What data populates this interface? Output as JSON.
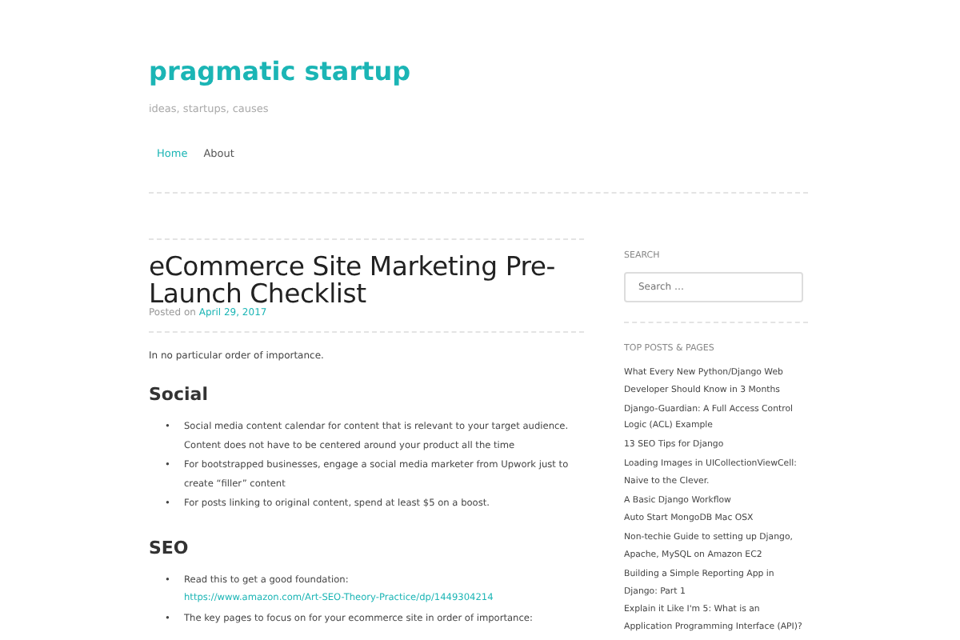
{
  "site": {
    "title": "pragmatic startup",
    "tagline": "ideas, startups, causes"
  },
  "nav": [
    {
      "label": "Home",
      "selected": true
    },
    {
      "label": "About",
      "selected": false
    }
  ],
  "post": {
    "title": "eCommerce Site Marketing Pre-Launch Checklist",
    "posted_label": "Posted on",
    "date": "April 29, 2017",
    "intro": "In no particular order of importance.",
    "bullet": "•",
    "sections": [
      {
        "heading": "Social",
        "items": [
          {
            "text": "Social media content calendar for content that is relevant to your target audience. Content does not have to be centered around your product all the time"
          },
          {
            "text": "For bootstrapped businesses, engage a social media marketer from Upwork just to create “filler” content"
          },
          {
            "text": "For posts linking to original content, spend at least $5 on a boost."
          }
        ]
      },
      {
        "heading": "SEO",
        "items": [
          {
            "text": "Read this to get a good foundation:",
            "link": "https://www.amazon.com/Art-SEO-Theory-Practice/dp/1449304214"
          },
          {
            "text": "The key pages to focus on for your ecommerce site in order of importance:"
          }
        ]
      }
    ]
  },
  "sidebar": {
    "search_heading": "SEARCH",
    "search_placeholder": "Search …",
    "top_heading": "TOP POSTS & PAGES",
    "top_posts": [
      "What Every New Python/Django Web Developer Should Know in 3 Months",
      "Django-Guardian: A Full Access Control Logic (ACL) Example",
      "13 SEO Tips for Django",
      "Loading Images in UICollectionViewCell: Naive to the Clever.",
      "A Basic Django Workflow",
      "Auto Start MongoDB Mac OSX",
      "Non-techie Guide to setting up Django, Apache, MySQL on Amazon EC2",
      "Building a Simple Reporting App in Django: Part 1",
      "Explain it Like I'm 5: What is an Application Programming Interface (API)?"
    ]
  }
}
